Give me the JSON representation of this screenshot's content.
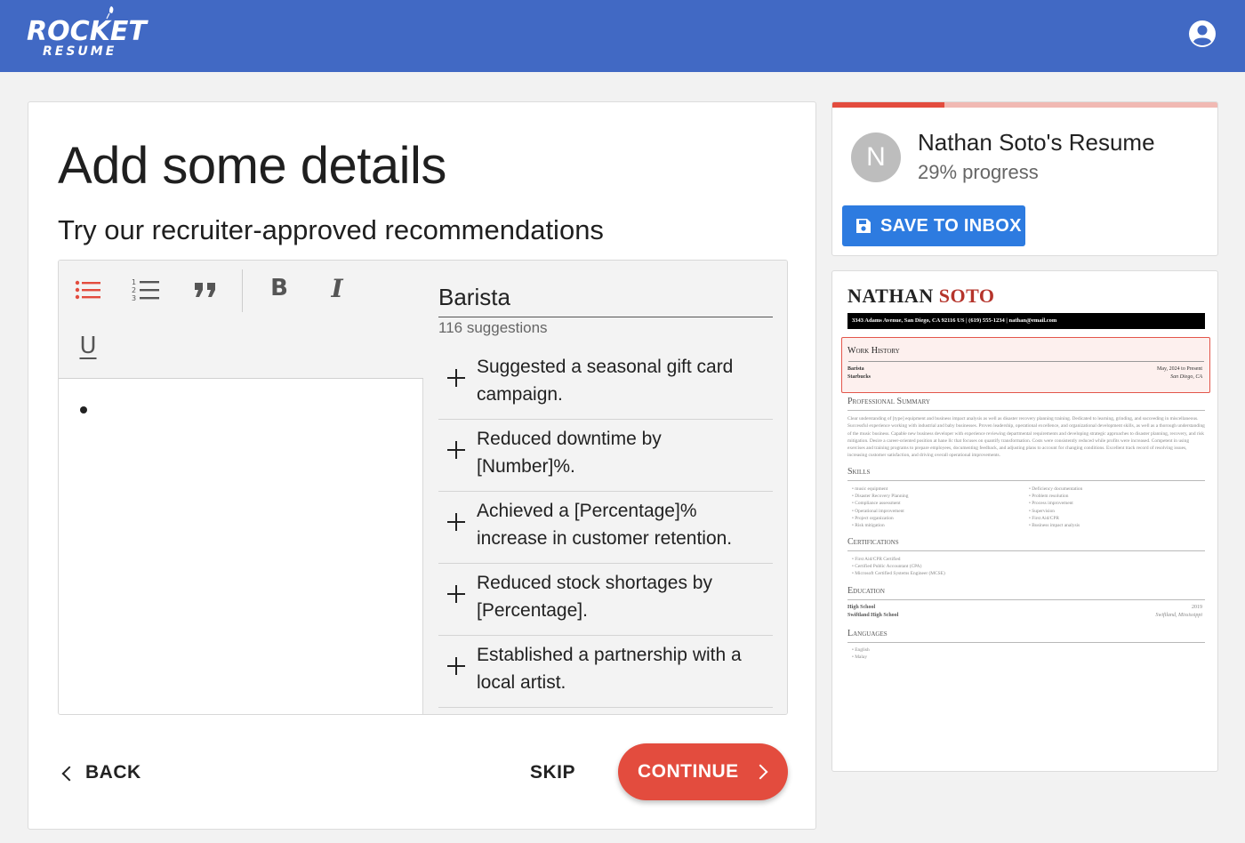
{
  "header": {
    "logo_line1": "ROCKET",
    "logo_line2": "RESUME",
    "account_icon": "account-circle-icon"
  },
  "main": {
    "title": "Add some details",
    "subtitle": "Try our recruiter-approved recommendations",
    "toolbar": [
      "bulleted-list-icon",
      "numbered-list-icon",
      "quote-icon",
      "bold-icon",
      "italic-icon",
      "underline-icon"
    ],
    "job_title": "Barista",
    "suggestion_count": "116 suggestions",
    "suggestions": [
      "Suggested a seasonal gift card campaign.",
      "Reduced downtime by [Number]%.",
      "Achieved a [Percentage]% increase in customer retention.",
      "Reduced stock shortages by [Percentage].",
      "Established a partnership with a local artist."
    ],
    "back_label": "BACK",
    "skip_label": "SKIP",
    "continue_label": "CONTINUE"
  },
  "sidebar": {
    "avatar_letter": "N",
    "resume_name": "Nathan Soto's Resume",
    "progress_text": "29% progress",
    "progress_fraction": 0.29,
    "save_label": "SAVE TO INBOX"
  },
  "preview": {
    "first_name": "NATHAN",
    "last_name": "SOTO",
    "contact": "3343 Adams Avenue, San Diego, CA 92116 US  |  (619) 555-1234  |  nathan@email.com",
    "work_history_title": "Work History",
    "job": "Barista",
    "company": "Starbucks",
    "dates": "May, 2024 to Present",
    "location": "San Diego, CA",
    "summary_title": "Professional Summary",
    "summary": "Clear understanding of [type] equipment and business impact analysis as well as disaster recovery planning training. Dedicated to learning, grinding, and succeeding in miscellaneous. Successful experience working with industrial and baby businesses. Proven leadership, operational excellence, and organizational development skills, as well as a thorough understanding of the music business. Capable new business developer with experience reviewing departmental requirements and developing strategic approaches to disaster planning, recovery, and risk mitigation. Desire a career-oriented position at hane llc that focuses on quantify transformation. Costs were consistently reduced while profits were increased. Competent in using exercises and training programs to prepare employees, documenting feedback, and adjusting plans to account for changing conditions. Excellent track record of resolving issues, increasing customer satisfaction, and driving overall operational improvements.",
    "skills_title": "Skills",
    "skills_left": [
      "music equipment",
      "Disaster Recovery Planning",
      "Compliance assessment",
      "Operational improvement",
      "Project organization",
      "Risk mitigation"
    ],
    "skills_right": [
      "Deficiency documentation",
      "Problem resolution",
      "Process improvement",
      "Supervision",
      "First Aid/CPR",
      "Business impact analysis"
    ],
    "certifications_title": "Certifications",
    "certifications": [
      "First Aid/CPR Certified",
      "Certified Public Accountant (CPA)",
      "Microsoft Certified Systems Engineer (MCSE)"
    ],
    "education_title": "Education",
    "degree": "High School",
    "year": "2019",
    "school": "Swiftland High School",
    "school_location": "Swiftland, Mississippi",
    "languages_title": "Languages",
    "languages": [
      "English",
      "Malay"
    ]
  },
  "colors": {
    "header_bg": "#4169c4",
    "accent_red": "#e34c3e",
    "save_blue": "#2d7be0"
  }
}
